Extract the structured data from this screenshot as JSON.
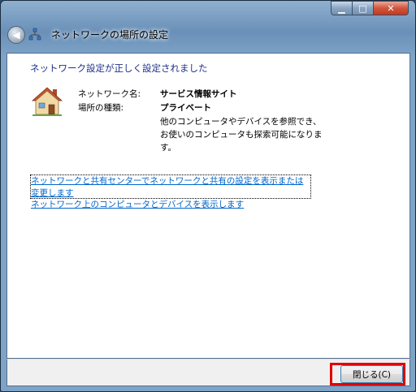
{
  "window": {
    "title": "ネットワークの場所の設定",
    "minimize_label": "▁",
    "maximize_label": "□",
    "close_label": "✕",
    "back_label": "◀"
  },
  "content": {
    "heading": "ネットワーク設定が正しく設定されました",
    "network_name_label": "ネットワーク名:",
    "network_name_value": "サービス情報サイト",
    "location_type_label": "場所の種類:",
    "location_type_value": "プライベート",
    "description": "他のコンピュータやデバイスを参照でき、お使いのコンピュータも探索可能になります。",
    "link_network_center": "ネットワークと共有センターでネットワークと共有の設定を表示または変更します",
    "link_view_devices": "ネットワーク上のコンピュータとデバイスを表示します"
  },
  "footer": {
    "close_button": "閉じる(C)"
  },
  "colors": {
    "heading": "#1e3287",
    "link": "#0066cc",
    "highlight": "#e00000"
  }
}
